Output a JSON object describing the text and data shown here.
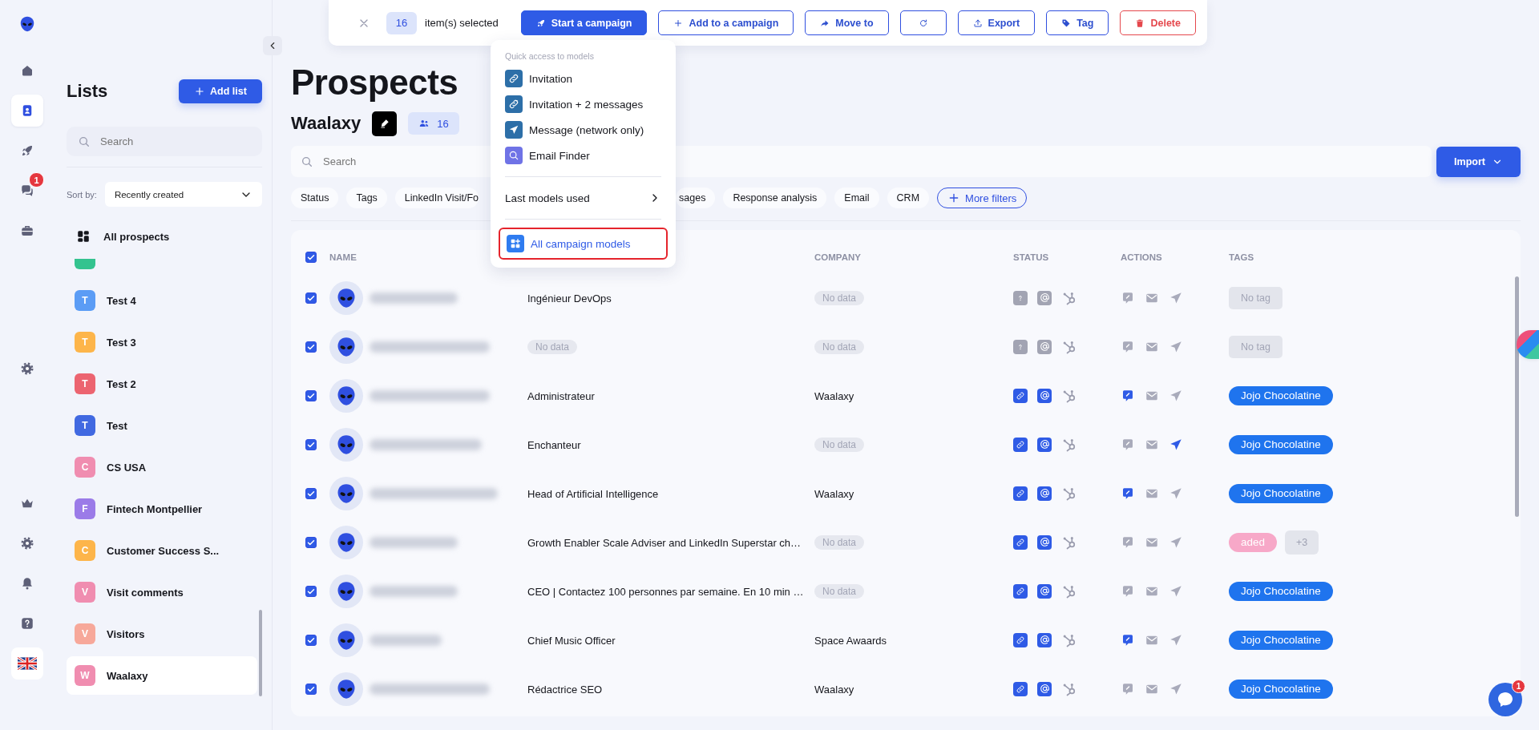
{
  "rail": {
    "items": [
      {
        "selected": false
      },
      {
        "selected": true
      },
      {
        "selected": false
      },
      {
        "selected": false,
        "badge": "1"
      },
      {
        "selected": false
      },
      {
        "selected": false
      },
      {
        "selected": false
      },
      {
        "selected": false
      },
      {
        "selected": false
      },
      {
        "selected": false
      }
    ]
  },
  "lists_panel": {
    "title": "Lists",
    "add_button": "Add list",
    "search_placeholder": "Search",
    "sort_label": "Sort by:",
    "sort_value": "Recently created",
    "all_prospects": "All prospects",
    "lists": [
      {
        "color": "#34c38f",
        "selected": false
      },
      {
        "initial": "T",
        "name": "Test 4",
        "color": "#5b9cf5",
        "selected": false
      },
      {
        "initial": "T",
        "name": "Test 3",
        "color": "#fdb54a",
        "selected": false
      },
      {
        "initial": "T",
        "name": "Test 2",
        "color": "#ec6470",
        "selected": false
      },
      {
        "initial": "T",
        "name": "Test",
        "color": "#4169e1",
        "selected": false
      },
      {
        "initial": "C",
        "name": "CS USA",
        "color": "#f08db0",
        "selected": false
      },
      {
        "initial": "F",
        "name": "Fintech Montpellier",
        "color": "#9b7be8",
        "selected": false
      },
      {
        "initial": "C",
        "name": "Customer Success S...",
        "color": "#fdb54a",
        "selected": false
      },
      {
        "initial": "V",
        "name": "Visit comments",
        "color": "#f08db0",
        "selected": false
      },
      {
        "initial": "V",
        "name": "Visitors",
        "color": "#f7a89a",
        "selected": false
      },
      {
        "initial": "W",
        "name": "Waalaxy",
        "color": "#f08db0",
        "selected": true
      }
    ]
  },
  "toolbar": {
    "count": "16",
    "count_label": "item(s) selected",
    "buttons": [
      {
        "label": "Start a campaign",
        "kind": "primary"
      },
      {
        "label": "Add to a campaign",
        "kind": "outline"
      },
      {
        "label": "Move to",
        "kind": "outline"
      },
      {
        "kind": "icon"
      },
      {
        "label": "Export",
        "kind": "outline"
      },
      {
        "label": "Tag",
        "kind": "outline"
      },
      {
        "label": "Delete",
        "kind": "danger"
      }
    ]
  },
  "page": {
    "title": "Prospects",
    "list_name": "Waalaxy",
    "member_count": "16",
    "search_placeholder": "Search",
    "import_button": "Import",
    "filters": [
      {
        "label": "Status"
      },
      {
        "label": "Tags"
      },
      {
        "label": "LinkedIn Visit/Fo"
      },
      {
        "label": "sages"
      },
      {
        "label": "Response analysis"
      },
      {
        "label": "Email"
      },
      {
        "label": "CRM"
      }
    ],
    "more_filters": "More filters"
  },
  "campaign_menu": {
    "heading": "Quick access to models",
    "items": [
      {
        "label": "Invitation"
      },
      {
        "label": "Invitation + 2 messages"
      },
      {
        "label": "Message (network only)"
      },
      {
        "label": "Email Finder"
      }
    ],
    "submenu": "Last models used",
    "footer": {
      "label": "All campaign models",
      "highlighted": true
    }
  },
  "table": {
    "all_checked": true,
    "columns": [
      "NAME",
      "COMPANY",
      "STATUS",
      "ACTIONS",
      "TAGS"
    ],
    "rows": [
      {
        "checked": true,
        "job": {
          "text": "Ingénieur DevOps",
          "kind": "text"
        },
        "company": {
          "text": "No data",
          "kind": "empty"
        },
        "linkedin_connected": false,
        "email_found": false,
        "message_sent": false,
        "campaign_running": false,
        "no_tag": "No tag"
      },
      {
        "checked": true,
        "job": {
          "text": "No data",
          "kind": "empty"
        },
        "company": {
          "text": "No data",
          "kind": "empty"
        },
        "linkedin_connected": false,
        "email_found": false,
        "message_sent": false,
        "campaign_running": false,
        "no_tag": "No tag"
      },
      {
        "checked": true,
        "job": {
          "text": "Administrateur",
          "kind": "text"
        },
        "company": {
          "text": "Waalaxy",
          "kind": "text"
        },
        "linkedin_connected": true,
        "email_found": true,
        "message_sent": true,
        "campaign_running": false,
        "tags": [
          {
            "label": "Jojo Chocolatine",
            "color": "#1f74ee"
          }
        ]
      },
      {
        "checked": true,
        "job": {
          "text": "Enchanteur",
          "kind": "text"
        },
        "company": {
          "text": "No data",
          "kind": "empty"
        },
        "linkedin_connected": true,
        "email_found": true,
        "message_sent": false,
        "campaign_running": true,
        "tags": [
          {
            "label": "Jojo Chocolatine",
            "color": "#1f74ee"
          }
        ]
      },
      {
        "checked": true,
        "job": {
          "text": "Head of Artificial Intelligence",
          "kind": "text"
        },
        "company": {
          "text": "Waalaxy",
          "kind": "text"
        },
        "linkedin_connected": true,
        "email_found": true,
        "message_sent": true,
        "campaign_running": false,
        "tags": [
          {
            "label": "Jojo Chocolatine",
            "color": "#1f74ee"
          }
        ]
      },
      {
        "checked": true,
        "job": {
          "text": "Growth Enabler Scale Adviser and LinkedIn Superstar ch…",
          "kind": "text"
        },
        "company": {
          "text": "No data",
          "kind": "empty"
        },
        "linkedin_connected": true,
        "email_found": true,
        "message_sent": false,
        "campaign_running": false,
        "tags": [
          {
            "label": "aded",
            "color": "#f7a8c8"
          }
        ],
        "more_tags": "+3"
      },
      {
        "checked": true,
        "job": {
          "text": "CEO | Contactez 100 personnes par semaine. En 10 min …",
          "kind": "text"
        },
        "company": {
          "text": "No data",
          "kind": "empty"
        },
        "linkedin_connected": true,
        "email_found": true,
        "message_sent": false,
        "campaign_running": false,
        "tags": [
          {
            "label": "Jojo Chocolatine",
            "color": "#1f74ee"
          }
        ]
      },
      {
        "checked": true,
        "job": {
          "text": "Chief Music Officer",
          "kind": "text"
        },
        "company": {
          "text": "Space Awaards",
          "kind": "text"
        },
        "linkedin_connected": true,
        "email_found": true,
        "message_sent": true,
        "campaign_running": false,
        "tags": [
          {
            "label": "Jojo Chocolatine",
            "color": "#1f74ee"
          }
        ]
      },
      {
        "checked": true,
        "job": {
          "text": "Rédactrice SEO",
          "kind": "text"
        },
        "company": {
          "text": "Waalaxy",
          "kind": "text"
        },
        "linkedin_connected": true,
        "email_found": true,
        "message_sent": false,
        "campaign_running": false,
        "tags": [
          {
            "label": "Jojo Chocolatine",
            "color": "#1f74ee"
          }
        ]
      }
    ]
  },
  "chat_launcher": {
    "badge": "1"
  }
}
